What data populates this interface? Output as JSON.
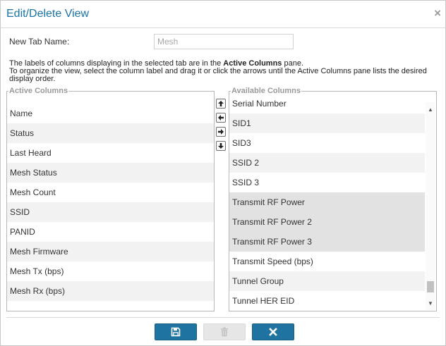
{
  "dialog": {
    "title": "Edit/Delete View",
    "close_glyph": "×"
  },
  "tab_name": {
    "label": "New Tab Name:",
    "value": "Mesh"
  },
  "instructions": {
    "line1_prefix": "The labels of columns displaying in the selected tab are in the ",
    "line1_bold": "Active Columns",
    "line1_suffix": " pane.",
    "line2": "To organize the view, select the column label and drag it or click the arrows until the Active Columns pane lists the desired display order."
  },
  "active_pane": {
    "legend": "Active Columns",
    "items": [
      "Name",
      "Status",
      "Last Heard",
      "Mesh Status",
      "Mesh Count",
      "SSID",
      "PANID",
      "Mesh Firmware",
      "Mesh Tx (bps)",
      "Mesh Rx (bps)"
    ]
  },
  "available_pane": {
    "legend": "Available Columns",
    "items": [
      "Serial Number",
      "SID1",
      "SID3",
      "SSID 2",
      "SSID 3",
      "Transmit RF Power",
      "Transmit RF Power 2",
      "Transmit RF Power 3",
      "Transmit Speed (bps)",
      "Tunnel Group",
      "Tunnel HER EID"
    ],
    "selected": [
      "Transmit RF Power",
      "Transmit RF Power 2",
      "Transmit RF Power 3"
    ],
    "scrollbar": {
      "up_glyph": "▲",
      "down_glyph": "▼"
    }
  },
  "arrow_buttons": {
    "icons": [
      "move-up-icon",
      "move-left-icon",
      "move-right-icon",
      "move-down-icon"
    ]
  },
  "footer": {
    "buttons": [
      {
        "name": "save-button",
        "icon": "floppy-disk-icon",
        "enabled": true
      },
      {
        "name": "delete-button",
        "icon": "trash-icon",
        "enabled": false
      },
      {
        "name": "cancel-button",
        "icon": "close-icon",
        "enabled": true
      }
    ]
  },
  "colors": {
    "accent": "#1f73a0",
    "title": "#1a73a8",
    "disabled_button": "#e6e6e6",
    "selected_row": "#e2e2e2",
    "alt_row": "#f2f2f2"
  }
}
